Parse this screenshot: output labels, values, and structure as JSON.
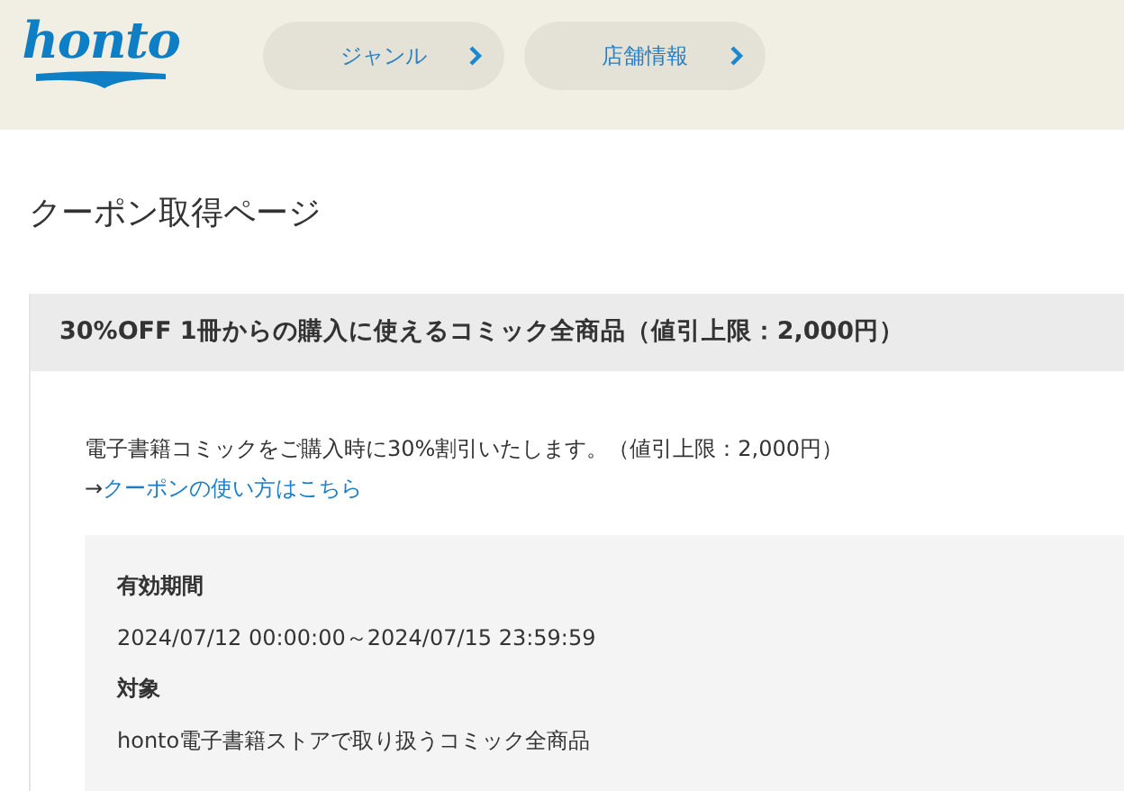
{
  "header": {
    "logo": "honto",
    "nav": [
      {
        "label": "ジャンル"
      },
      {
        "label": "店舗情報"
      }
    ]
  },
  "page_title": "クーポン取得ページ",
  "coupon": {
    "title": "30%OFF 1冊からの購入に使えるコミック全商品（値引上限：2,000円）",
    "description": "電子書籍コミックをご購入時に30%割引いたします。（値引上限：2,000円）",
    "link_prefix": "→",
    "link": "クーポンの使い方はこちら",
    "details": [
      {
        "label": "有効期間",
        "value": "2024/07/12 00:00:00～2024/07/15 23:59:59"
      },
      {
        "label": "対象",
        "value": "honto電子書籍ストアで取り扱うコミック全商品"
      }
    ]
  }
}
